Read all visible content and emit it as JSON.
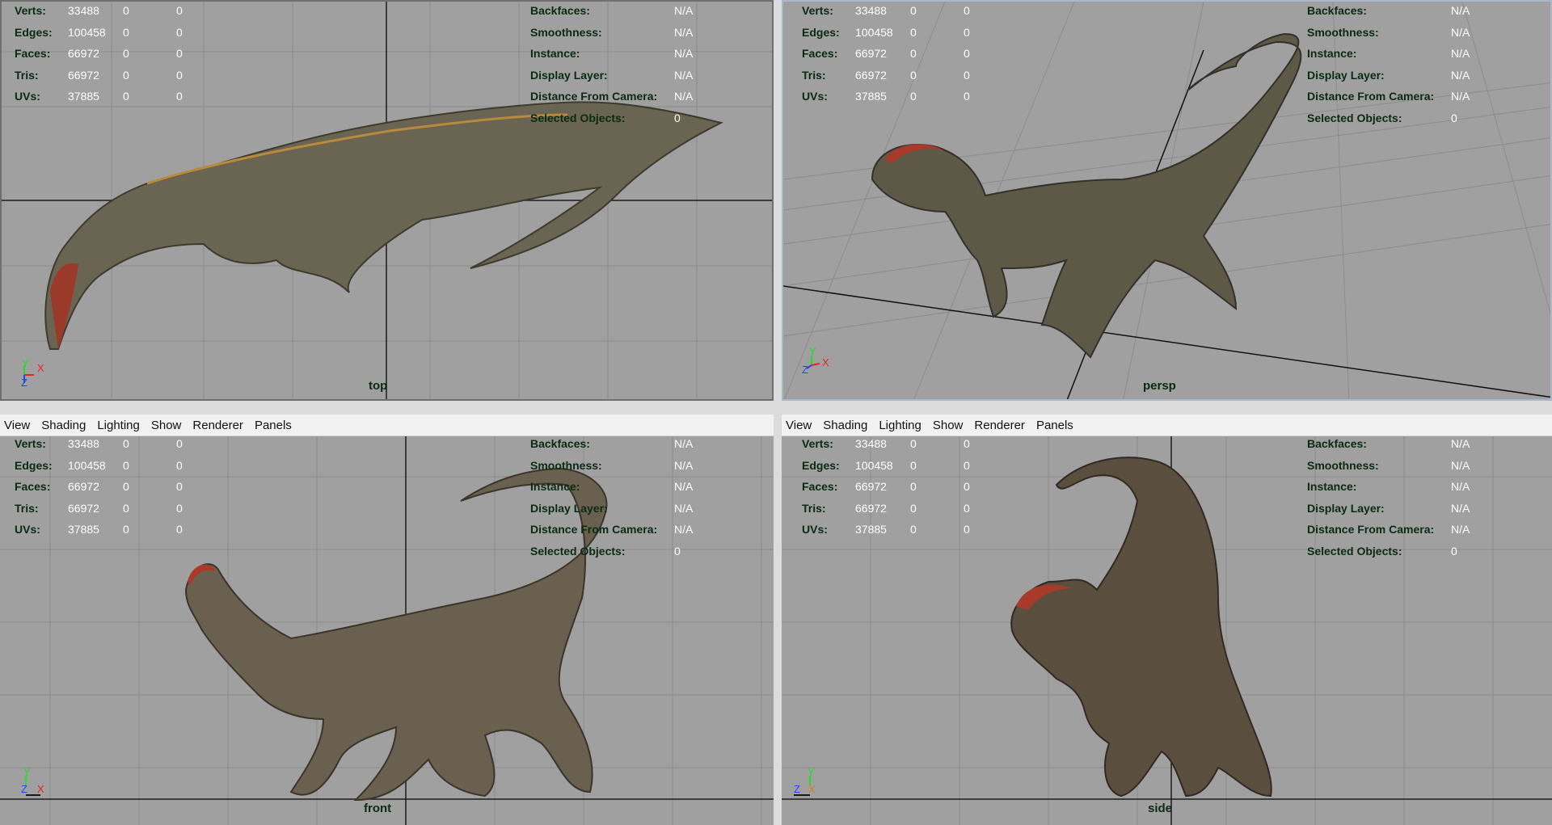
{
  "viewports": [
    {
      "camera": "top",
      "stats": [
        {
          "label": "Verts:",
          "value": "33488",
          "sel": "0",
          "sel2": "0"
        },
        {
          "label": "Edges:",
          "value": "100458",
          "sel": "0",
          "sel2": "0"
        },
        {
          "label": "Faces:",
          "value": "66972",
          "sel": "0",
          "sel2": "0"
        },
        {
          "label": "Tris:",
          "value": "66972",
          "sel": "0",
          "sel2": "0"
        },
        {
          "label": "UVs:",
          "value": "37885",
          "sel": "0",
          "sel2": "0"
        }
      ],
      "info": [
        {
          "label": "Backfaces:",
          "value": "N/A"
        },
        {
          "label": "Smoothness:",
          "value": "N/A"
        },
        {
          "label": "Instance:",
          "value": "N/A"
        },
        {
          "label": "Display Layer:",
          "value": "N/A"
        },
        {
          "label": "Distance From Camera:",
          "value": "N/A"
        },
        {
          "label": "Selected Objects:",
          "value": "0"
        }
      ]
    },
    {
      "camera": "persp",
      "stats": [
        {
          "label": "Verts:",
          "value": "33488",
          "sel": "0",
          "sel2": "0"
        },
        {
          "label": "Edges:",
          "value": "100458",
          "sel": "0",
          "sel2": "0"
        },
        {
          "label": "Faces:",
          "value": "66972",
          "sel": "0",
          "sel2": "0"
        },
        {
          "label": "Tris:",
          "value": "66972",
          "sel": "0",
          "sel2": "0"
        },
        {
          "label": "UVs:",
          "value": "37885",
          "sel": "0",
          "sel2": "0"
        }
      ],
      "info": [
        {
          "label": "Backfaces:",
          "value": "N/A"
        },
        {
          "label": "Smoothness:",
          "value": "N/A"
        },
        {
          "label": "Instance:",
          "value": "N/A"
        },
        {
          "label": "Display Layer:",
          "value": "N/A"
        },
        {
          "label": "Distance From Camera:",
          "value": "N/A"
        },
        {
          "label": "Selected Objects:",
          "value": "0"
        }
      ]
    },
    {
      "camera": "front",
      "stats": [
        {
          "label": "Verts:",
          "value": "33488",
          "sel": "0",
          "sel2": "0"
        },
        {
          "label": "Edges:",
          "value": "100458",
          "sel": "0",
          "sel2": "0"
        },
        {
          "label": "Faces:",
          "value": "66972",
          "sel": "0",
          "sel2": "0"
        },
        {
          "label": "Tris:",
          "value": "66972",
          "sel": "0",
          "sel2": "0"
        },
        {
          "label": "UVs:",
          "value": "37885",
          "sel": "0",
          "sel2": "0"
        }
      ],
      "info": [
        {
          "label": "Backfaces:",
          "value": "N/A"
        },
        {
          "label": "Smoothness:",
          "value": "N/A"
        },
        {
          "label": "Instance:",
          "value": "N/A"
        },
        {
          "label": "Display Layer:",
          "value": "N/A"
        },
        {
          "label": "Distance From Camera:",
          "value": "N/A"
        },
        {
          "label": "Selected Objects:",
          "value": "0"
        }
      ]
    },
    {
      "camera": "side",
      "stats": [
        {
          "label": "Verts:",
          "value": "33488",
          "sel": "0",
          "sel2": "0"
        },
        {
          "label": "Edges:",
          "value": "100458",
          "sel": "0",
          "sel2": "0"
        },
        {
          "label": "Faces:",
          "value": "66972",
          "sel": "0",
          "sel2": "0"
        },
        {
          "label": "Tris:",
          "value": "66972",
          "sel": "0",
          "sel2": "0"
        },
        {
          "label": "UVs:",
          "value": "37885",
          "sel": "0",
          "sel2": "0"
        }
      ],
      "info": [
        {
          "label": "Backfaces:",
          "value": "N/A"
        },
        {
          "label": "Smoothness:",
          "value": "N/A"
        },
        {
          "label": "Instance:",
          "value": "N/A"
        },
        {
          "label": "Display Layer:",
          "value": "N/A"
        },
        {
          "label": "Distance From Camera:",
          "value": "N/A"
        },
        {
          "label": "Selected Objects:",
          "value": "0"
        }
      ]
    }
  ],
  "menus": {
    "left": [
      "View",
      "Shading",
      "Lighting",
      "Show",
      "Renderer",
      "Panels"
    ],
    "right": [
      "View",
      "Shading",
      "Lighting",
      "Show",
      "Renderer",
      "Panels"
    ]
  },
  "axes": {
    "y": "Y",
    "z": "Z",
    "x": "X",
    "colors": {
      "y": "#22dd22",
      "z": "#2244ff",
      "x": "#ee2222"
    }
  },
  "colors": {
    "viewport_bg": "#a0a0a0",
    "grid": "#8c8c8c",
    "grid_axis": "#1a1a1a",
    "hud_label": "#0b2a12",
    "hud_value": "#ffffff",
    "active_border": "#aab8cc"
  }
}
